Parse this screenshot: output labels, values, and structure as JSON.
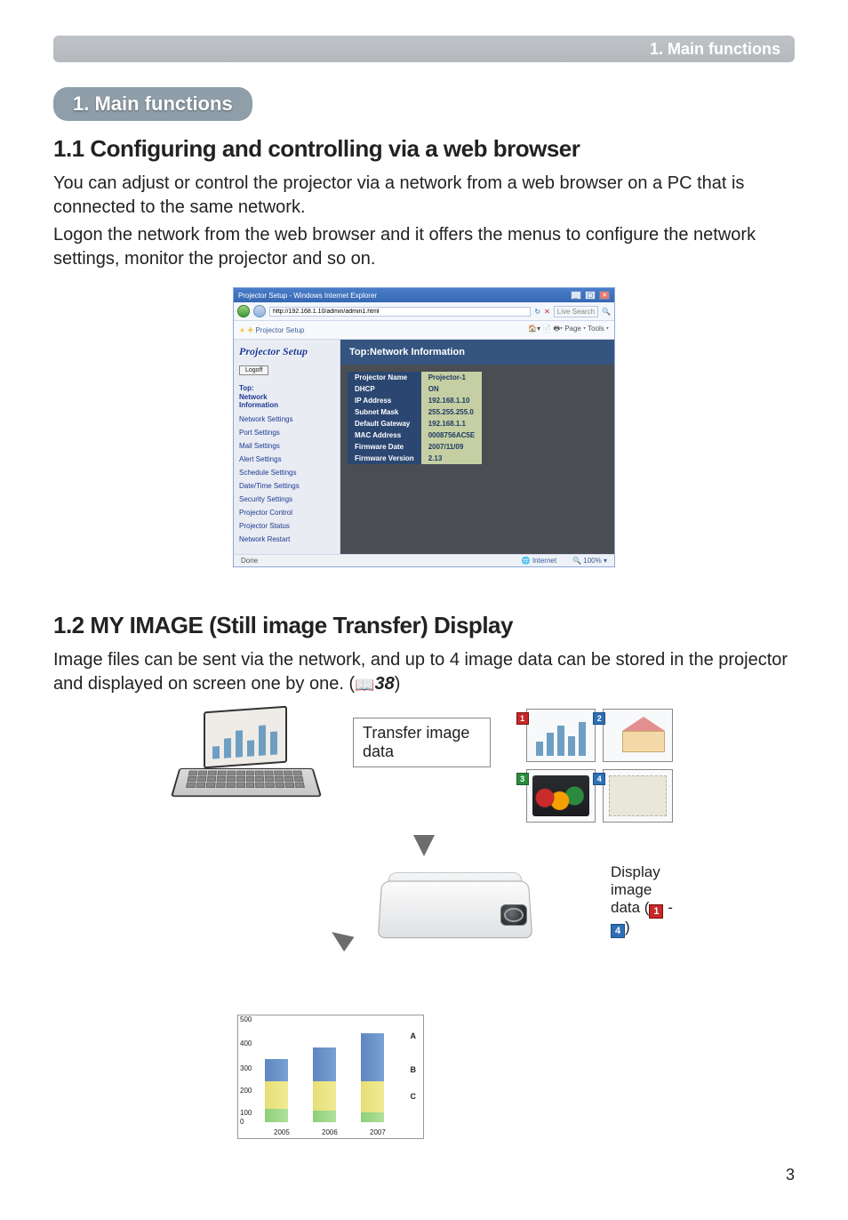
{
  "header": {
    "section_label": "1. Main functions"
  },
  "pill": "1. Main functions",
  "sec11": {
    "title": "1.1 Configuring and controlling via a web browser",
    "para1": "You can adjust or control the projector via a network from a web browser on a PC that is connected to the same network.",
    "para2": "Logon the network from the web browser and it offers the menus to configure the network settings, monitor the projector and so on."
  },
  "ie": {
    "title": "Projector Setup - Windows Internet Explorer",
    "url": "http://192.168.1.10/admin/admin1.html",
    "search_placeholder": "Live Search",
    "tab": "Projector Setup",
    "toolbar_right": "Page ▾   Tools ▾",
    "side_title": "Projector Setup",
    "logoff": "Logoff",
    "side_top_l1": "Top:",
    "side_top_l2": "Network",
    "side_top_l3": "Information",
    "side_links": [
      "Network Settings",
      "Port Settings",
      "Mail Settings",
      "Alert Settings",
      "Schedule Settings",
      "Date/Time Settings",
      "Security Settings",
      "Projector Control",
      "Projector Status",
      "Network Restart"
    ],
    "main_title": "Top:Network Information",
    "rows": [
      {
        "l": "Projector Name",
        "v": "Projector-1"
      },
      {
        "l": "DHCP",
        "v": "ON"
      },
      {
        "l": "IP Address",
        "v": "192.168.1.10"
      },
      {
        "l": "Subnet Mask",
        "v": "255.255.255.0"
      },
      {
        "l": "Default Gateway",
        "v": "192.168.1.1"
      },
      {
        "l": "MAC Address",
        "v": "0008756AC5E"
      },
      {
        "l": "Firmware Date",
        "v": "2007/11/09"
      },
      {
        "l": "Firmware Version",
        "v": "2.13"
      }
    ],
    "status_done": "Done",
    "status_zone": "Internet",
    "status_zoom": "100%"
  },
  "sec12": {
    "title": "1.2 MY IMAGE (Still image Transfer) Display",
    "para": "Image files can be sent via the network, and up to 4 image data can be stored in the projector and displayed on screen one by one. (",
    "ref": "38",
    "para_end": ")",
    "transfer_caption": "Transfer image data",
    "display_caption_pre": "Display image data (",
    "display_caption_mid": " - ",
    "display_caption_post": ")",
    "thumb_nums": [
      "1",
      "2",
      "3",
      "4"
    ]
  },
  "chart_data": {
    "type": "bar",
    "stacked": true,
    "categories": [
      "2005",
      "2006",
      "2007"
    ],
    "series": [
      {
        "name": "A",
        "values": [
          120,
          180,
          250
        ]
      },
      {
        "name": "B",
        "values": [
          140,
          150,
          160
        ]
      },
      {
        "name": "C",
        "values": [
          70,
          60,
          50
        ]
      }
    ],
    "ylim": [
      0,
      500
    ],
    "yticks": [
      0,
      100,
      200,
      300,
      400,
      500
    ],
    "xlabel": "",
    "ylabel": "",
    "title": ""
  },
  "page_number": "3"
}
